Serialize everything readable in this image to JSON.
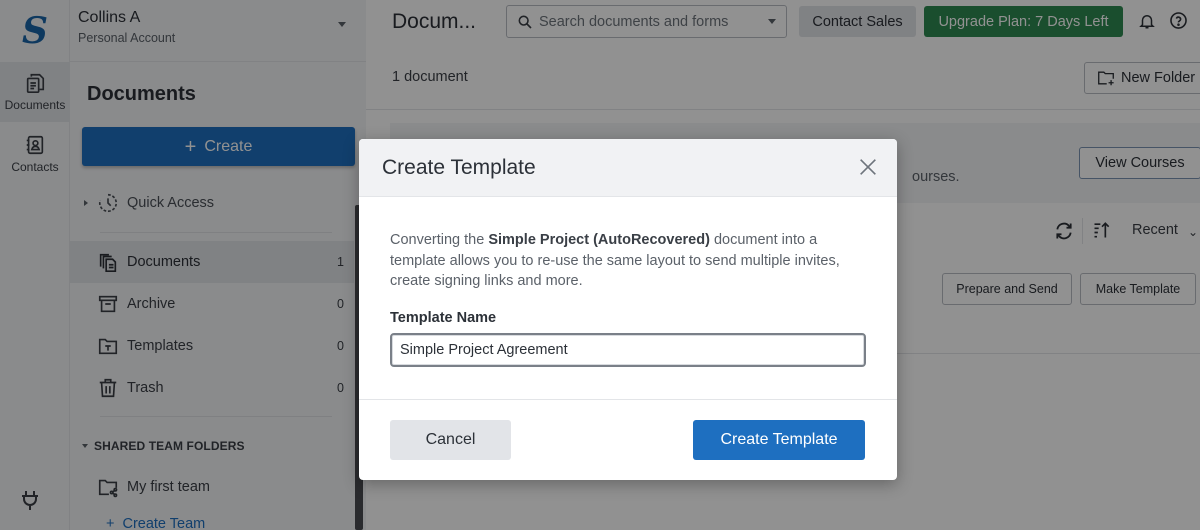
{
  "app": {
    "logo_letter": "S",
    "brand_color": "#1e6fc0",
    "upgrade_color": "#2e8a52"
  },
  "account": {
    "name": "Collins A",
    "type": "Personal Account"
  },
  "rail": {
    "items": [
      {
        "label": "Documents",
        "icon": "documents-icon",
        "active": true
      },
      {
        "label": "Contacts",
        "icon": "contacts-icon",
        "active": false
      }
    ],
    "bottom_icon": "plug-icon"
  },
  "sidebar": {
    "title": "Documents",
    "create_label": "Create",
    "quick_access_label": "Quick Access",
    "items": [
      {
        "label": "Documents",
        "count": "1",
        "icon": "documents-stack-icon",
        "active": true
      },
      {
        "label": "Archive",
        "count": "0",
        "icon": "archive-icon",
        "active": false
      },
      {
        "label": "Templates",
        "count": "0",
        "icon": "template-folder-icon",
        "active": false
      },
      {
        "label": "Trash",
        "count": "0",
        "icon": "trash-icon",
        "active": false
      }
    ],
    "shared_section_label": "SHARED TEAM FOLDERS",
    "teams": [
      {
        "label": "My first team",
        "icon": "shared-folder-icon"
      }
    ],
    "create_team_label": "Create Team"
  },
  "header": {
    "title": "Docum...",
    "search_placeholder": "Search documents and forms",
    "contact_sales_label": "Contact Sales",
    "upgrade_label": "Upgrade Plan: 7 Days Left"
  },
  "main": {
    "document_count": "1 document",
    "new_folder_label": "New Folder",
    "banner_text_fragment": "ourses.",
    "view_courses_label": "View Courses",
    "sort_label": "Recent",
    "row_actions": {
      "prepare_send_label": "Prepare and Send",
      "make_template_label": "Make Template"
    }
  },
  "modal": {
    "title": "Create Template",
    "description_prefix": "Converting the ",
    "document_name": "Simple Project (AutoRecovered)",
    "description_suffix": " document into a template allows you to re-use the same layout to send multiple invites, create signing links and more.",
    "field_label": "Template Name",
    "field_value": "Simple Project Agreement",
    "cancel_label": "Cancel",
    "submit_label": "Create Template"
  }
}
